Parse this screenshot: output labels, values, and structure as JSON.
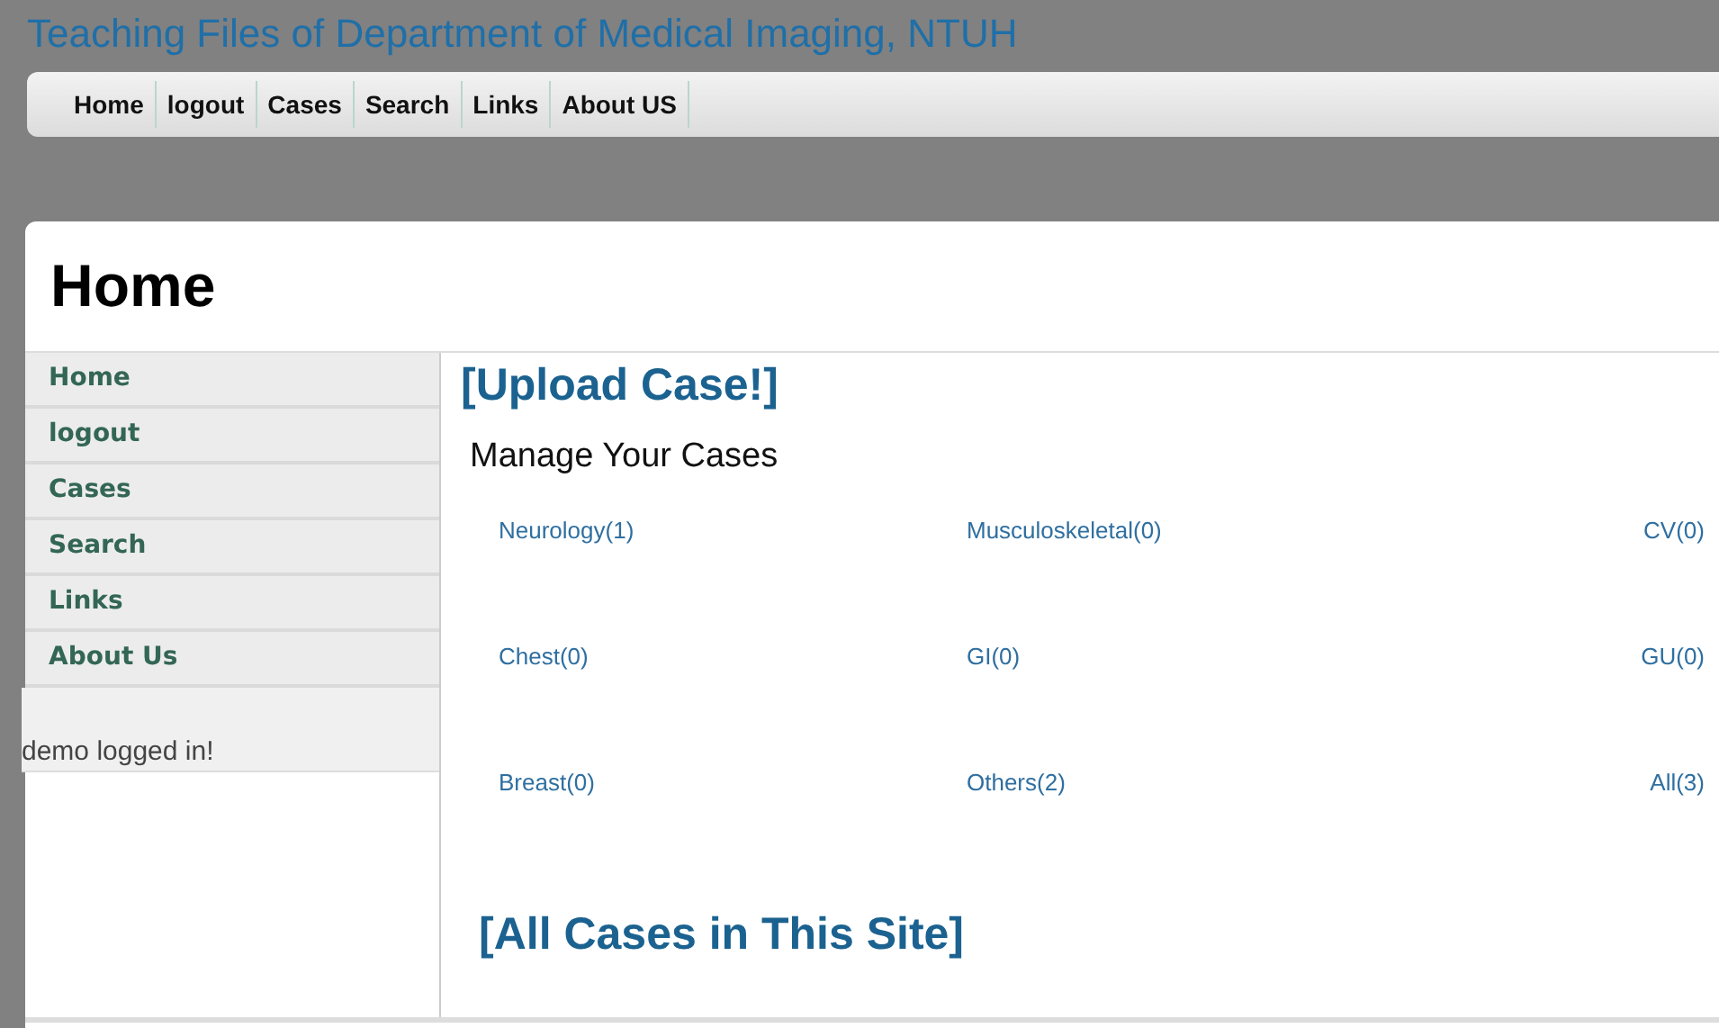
{
  "site_title": "Teaching Files of Department of Medical Imaging, NTUH",
  "top_nav": [
    {
      "label": "Home"
    },
    {
      "label": "logout"
    },
    {
      "label": "Cases"
    },
    {
      "label": "Search"
    },
    {
      "label": "Links"
    },
    {
      "label": "About US"
    }
  ],
  "page_heading": "Home",
  "sidebar": {
    "items": [
      {
        "label": "Home"
      },
      {
        "label": "logout"
      },
      {
        "label": "Cases"
      },
      {
        "label": "Search"
      },
      {
        "label": "Links"
      },
      {
        "label": "About Us"
      }
    ],
    "status": "demo logged in!"
  },
  "upload_link": "[Upload Case!]",
  "section_title": "Manage Your Cases",
  "categories": [
    {
      "label": "Neurology(1)"
    },
    {
      "label": "Musculoskeletal(0)"
    },
    {
      "label": "CV(0)"
    },
    {
      "label": "Chest(0)"
    },
    {
      "label": "GI(0)"
    },
    {
      "label": "GU(0)"
    },
    {
      "label": "Breast(0)"
    },
    {
      "label": "Others(2)"
    },
    {
      "label": "All(3)"
    }
  ],
  "all_cases_link": "[All Cases in This Site]"
}
